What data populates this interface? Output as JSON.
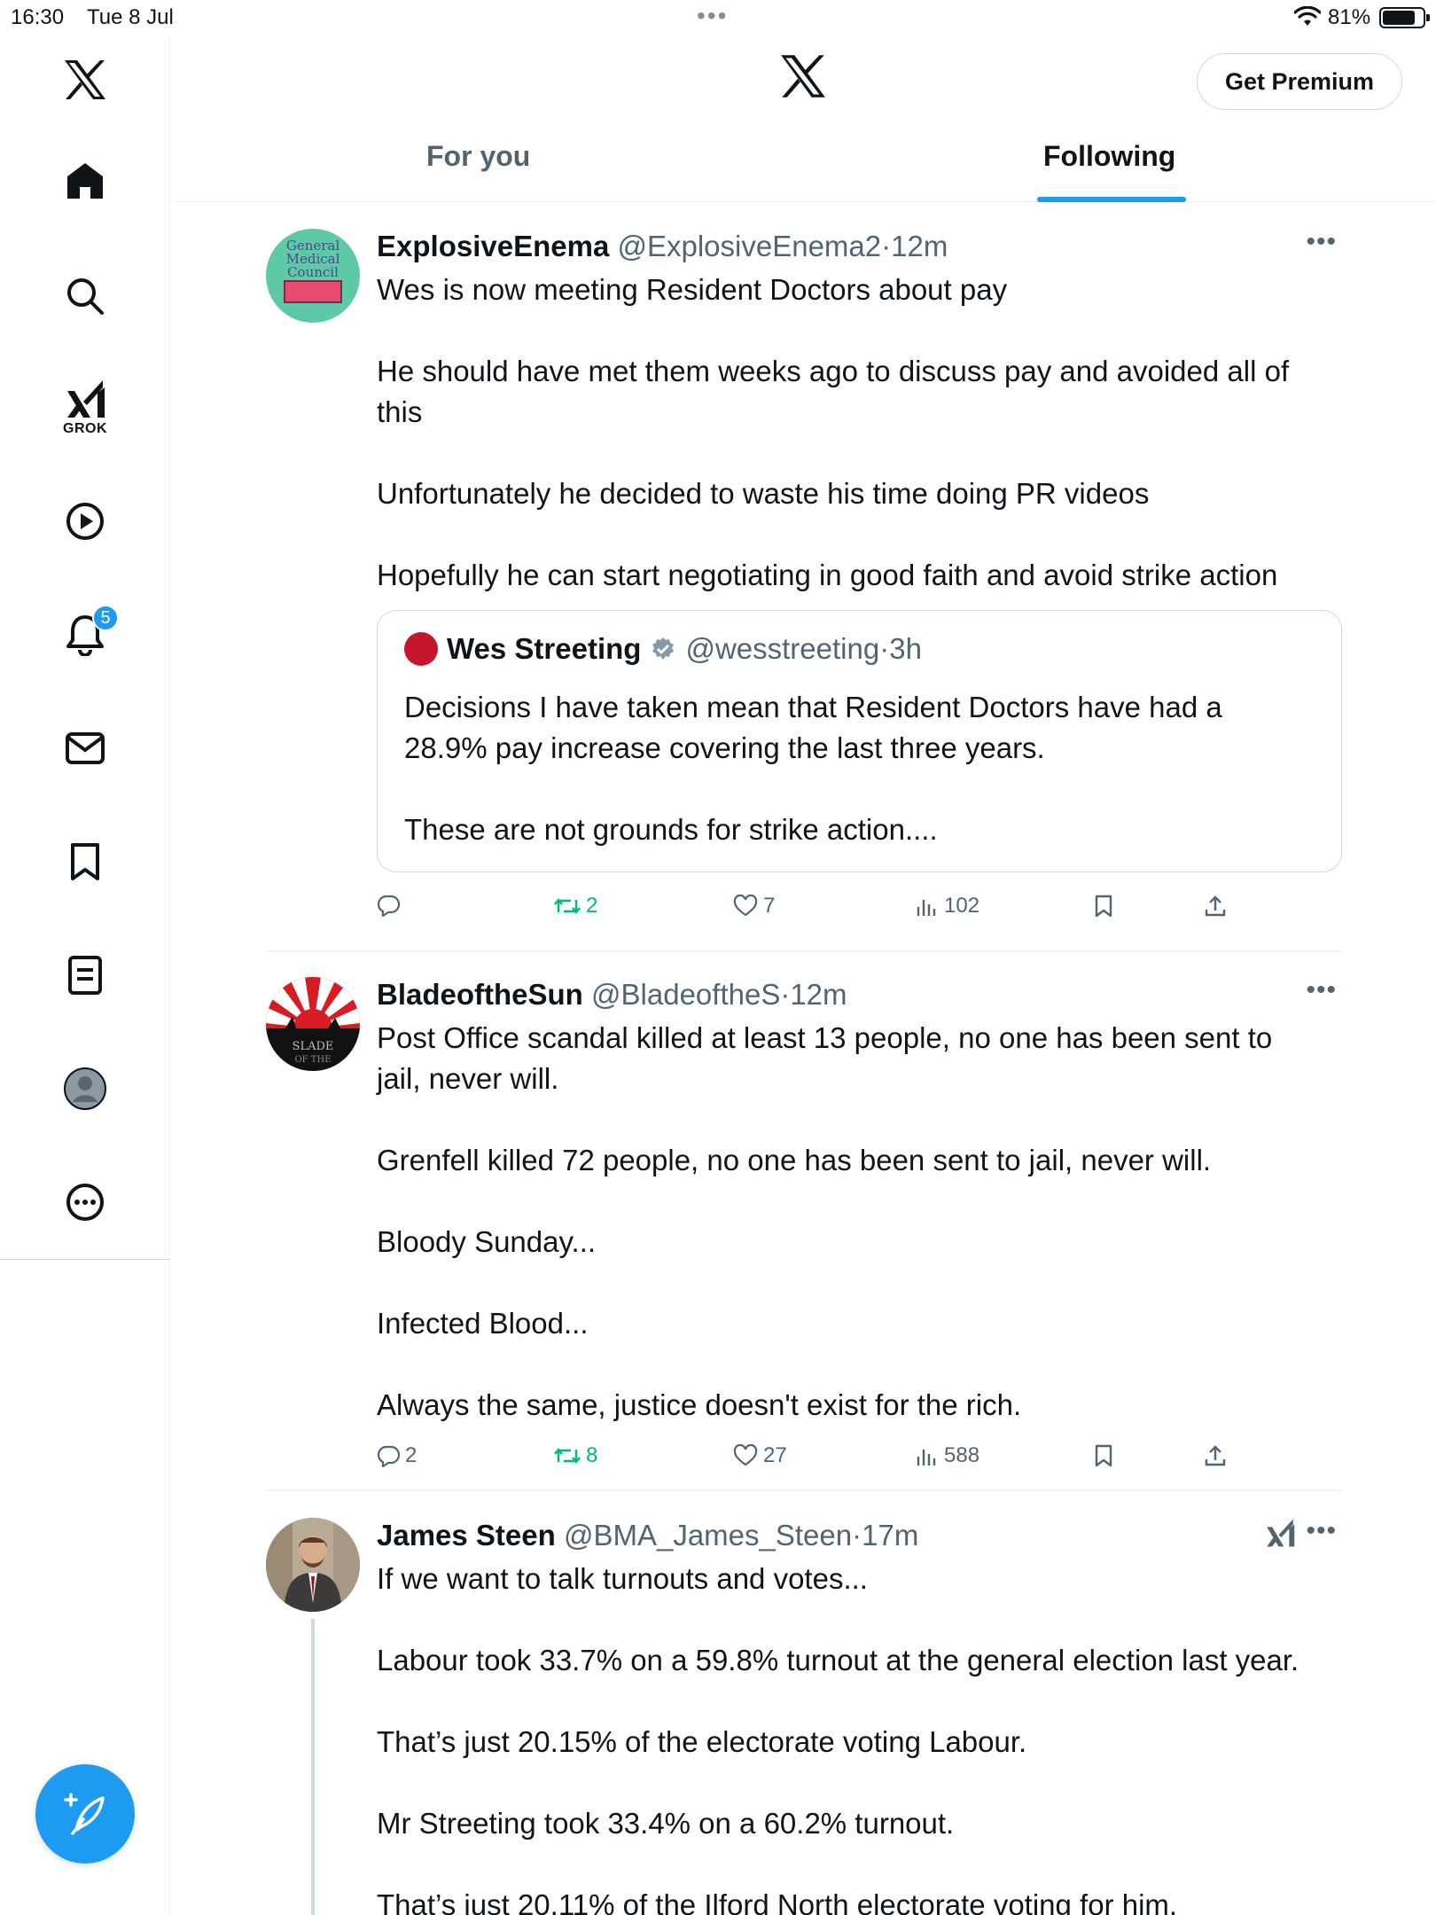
{
  "status_bar": {
    "time": "16:30",
    "date": "Tue 8 Jul",
    "battery": "81%"
  },
  "header": {
    "premium_button": "Get Premium",
    "tabs": [
      {
        "label": "For you",
        "active": false
      },
      {
        "label": "Following",
        "active": true
      }
    ]
  },
  "sidebar": {
    "grok_label": "GROK",
    "notifications_badge": "5"
  },
  "tweets": [
    {
      "name": "ExplosiveEnema",
      "handle": "@ExplosiveEnema2",
      "sep": "·",
      "ago": "12m",
      "lines": [
        "Wes is now meeting Resident Doctors about pay",
        "He should have met them weeks ago to discuss pay and avoided all of",
        "this",
        "Unfortunately he decided to waste his time doing PR videos",
        "Hopefully he can start negotiating in good faith and avoid strike action"
      ],
      "avatar_text": [
        "General",
        "Medical",
        "Council"
      ],
      "quote": {
        "name": "Wes Streeting",
        "handle": "@wesstreeting",
        "sep": "·",
        "ago": "3h",
        "lines": [
          "Decisions I have taken mean that Resident Doctors have had a",
          "28.9% pay increase covering the last three years.",
          "These are not grounds for strike action...."
        ]
      },
      "replies": "",
      "retweets": "2",
      "likes": "7",
      "views": "102"
    },
    {
      "name": "BladeoftheSun",
      "handle": "@BladeoftheS",
      "sep": "·",
      "ago": "12m",
      "lines": [
        "Post Office scandal killed at least 13 people, no one has been sent to",
        "jail, never will.",
        "Grenfell killed 72 people, no one has been sent to jail, never will.",
        "Bloody Sunday...",
        "Infected Blood...",
        "Always the same, justice doesn't exist for the rich."
      ],
      "replies": "2",
      "retweets": "8",
      "likes": "27",
      "views": "588"
    },
    {
      "name": "James Steen",
      "handle": "@BMA_James_Steen",
      "sep": "·",
      "ago": "17m",
      "lines": [
        "If we want to talk turnouts and votes...",
        "Labour took 33.7% on a 59.8% turnout at the general election last year.",
        "That’s just 20.15% of the electorate voting Labour.",
        "Mr Streeting took 33.4% on a 60.2% turnout.",
        "That’s just 20.11% of the Ilford North electorate voting for him."
      ]
    }
  ],
  "icons": {
    "x_logo": "x-logo-icon",
    "home": "home-icon",
    "search": "search-icon",
    "grok": "grok-icon",
    "video": "play-icon",
    "notifications": "bell-icon",
    "messages": "mail-icon",
    "bookmarks": "bookmark-icon",
    "lists": "list-icon",
    "profile": "profile-icon",
    "more": "more-circle-icon",
    "compose": "compose-icon"
  },
  "colors": {
    "accent": "#1d9bf0",
    "retweet": "#00ba7c",
    "muted": "#536471"
  }
}
